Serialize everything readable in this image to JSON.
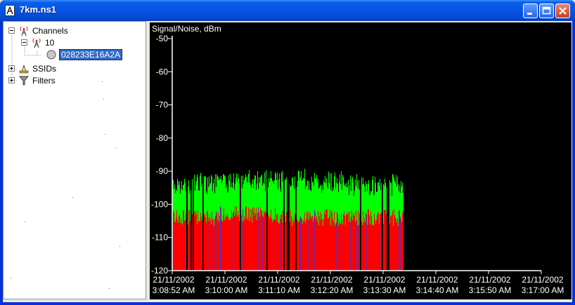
{
  "window": {
    "title": "7km.ns1",
    "buttons": [
      "minimize",
      "maximize",
      "close"
    ]
  },
  "tree": {
    "nodes": [
      {
        "label": "Channels",
        "icon": "antenna-icon",
        "expander": "minus",
        "level": 0
      },
      {
        "label": "10",
        "icon": "antenna-icon",
        "expander": "minus",
        "level": 1
      },
      {
        "label": "028233E16A2A",
        "icon": "circle-icon",
        "expander": "none",
        "level": 2,
        "selected": true
      },
      {
        "label": "SSIDs",
        "icon": "ssid-icon",
        "expander": "plus",
        "level": 0
      },
      {
        "label": "Filters",
        "icon": "funnel-icon",
        "expander": "plus",
        "level": 0
      }
    ]
  },
  "chart_data": {
    "type": "bar",
    "ylabel": "Signal/Noise, dBm",
    "ylim": [
      -120,
      -50
    ],
    "yticks": [
      "-50",
      "-60",
      "-70",
      "-80",
      "-90",
      "-100",
      "-110",
      "-120"
    ],
    "xticks": [
      {
        "date": "21/11/2002",
        "time": "3:08:52 AM"
      },
      {
        "date": "21/11/2002",
        "time": "3:10:00 AM"
      },
      {
        "date": "21/11/2002",
        "time": "3:11:10 AM"
      },
      {
        "date": "21/11/2002",
        "time": "3:12:20 AM"
      },
      {
        "date": "21/11/2002",
        "time": "3:13:30 AM"
      },
      {
        "date": "21/11/2002",
        "time": "3:14:40 AM"
      },
      {
        "date": "21/11/2002",
        "time": "3:15:50 AM"
      },
      {
        "date": "21/11/2002",
        "time": "3:17:00 AM"
      }
    ],
    "colors": {
      "signal": "#00ff00",
      "noise": "#ff0000",
      "overlap": "#6a2aa0",
      "background": "#000000",
      "axis": "#ffffff"
    },
    "signal_segments": [
      {
        "from": 0.0,
        "to": 0.8,
        "signal": -93,
        "noise": -104
      },
      {
        "from": 0.8,
        "to": 2.0,
        "signal": -92,
        "noise": -103
      },
      {
        "from": 2.0,
        "to": 3.2,
        "signal": -92,
        "noise": -104
      },
      {
        "from": 3.2,
        "to": 4.38,
        "signal": -93,
        "noise": -104
      }
    ]
  }
}
